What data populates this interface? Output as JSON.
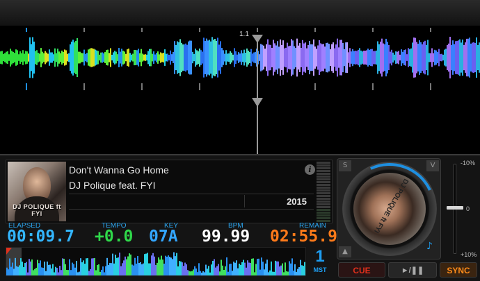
{
  "waveform": {
    "beat_marker": "1.1"
  },
  "track": {
    "title": "Don't Wanna Go Home",
    "artist": "DJ Polique feat. FYI",
    "year": "2015",
    "cover_text": "DJ POLIQUE ft FYI"
  },
  "readouts": {
    "elapsed_label": "ELAPSED",
    "elapsed": "00:09.7",
    "tempo_label": "TEMPO",
    "tempo": "+0.0",
    "key_label": "KEY",
    "key": "07A",
    "bpm_label": "BPM",
    "bpm": "99.99",
    "remain_label": "REMAIN",
    "remain": "02:55.9"
  },
  "deck": {
    "number": "1",
    "mode": "MST"
  },
  "jog": {
    "top_left": "S",
    "top_right": "V",
    "bottom_left": "▲",
    "platter_text": "DJ POLIQUE ft FYI"
  },
  "pitch": {
    "top": "-10%",
    "mid": "0",
    "bottom": "+10%",
    "value": 0.5
  },
  "transport": {
    "cue": "CUE",
    "play": "►/❚❚",
    "sync": "SYNC"
  },
  "colors": {
    "elapsed": "#33b6ff",
    "tempo": "#2fd84a",
    "key": "#33a6ff",
    "bpm": "#ffffff",
    "remain": "#ff7a1a",
    "accent": "#1e9df0"
  }
}
